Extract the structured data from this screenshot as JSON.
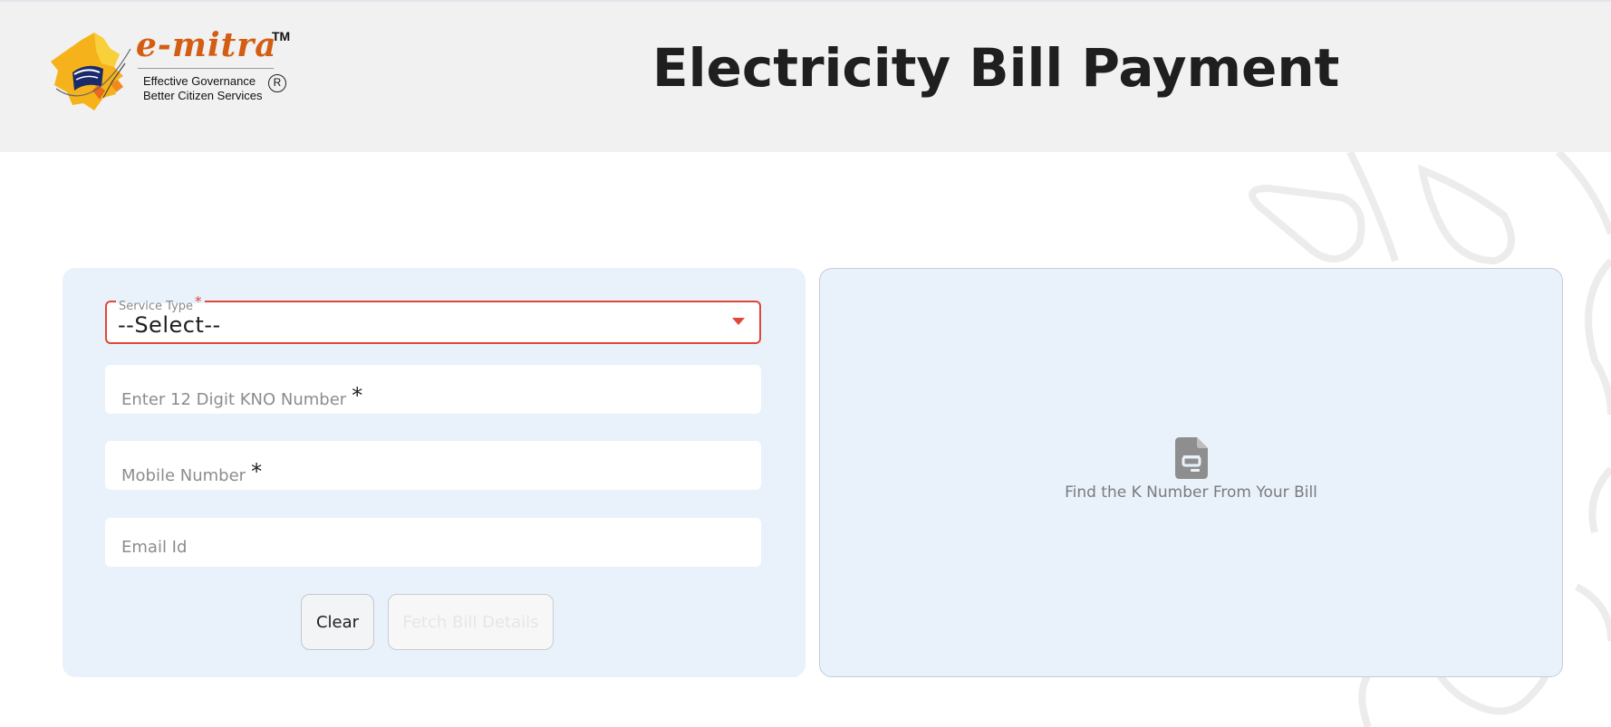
{
  "header": {
    "logo": {
      "wordmark": "e-mitra",
      "trademark": "TM",
      "tagline_1": "Effective Governance",
      "tagline_2": "Better Citizen Services",
      "registered": "R"
    },
    "title": "Electricity Bill Payment"
  },
  "form": {
    "service_type": {
      "label": "Service Type",
      "required_mark": "*",
      "value": "--Select--"
    },
    "kno": {
      "placeholder": "Enter 12 Digit KNO Number",
      "required_mark": "*"
    },
    "mobile": {
      "placeholder": "Mobile Number",
      "required_mark": "*"
    },
    "email": {
      "placeholder": "Email Id"
    },
    "buttons": {
      "clear_label": "Clear",
      "fetch_label": "Fetch Bill Details"
    }
  },
  "info_panel": {
    "icon": "document-icon",
    "text": "Find the K Number From Your Bill"
  },
  "colors": {
    "header_bg": "#f1f1f1",
    "card_bg": "#e9f1fb",
    "required_red": "#e0463a",
    "logo_orange": "#d35d13",
    "title_text": "#1f1f1f"
  }
}
